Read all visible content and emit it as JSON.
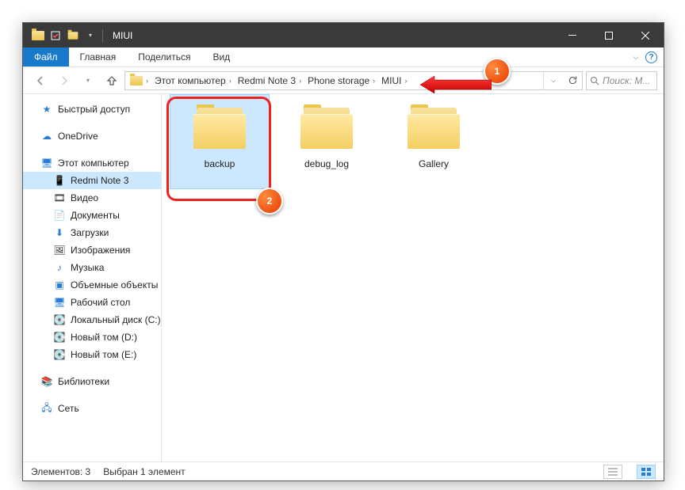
{
  "window": {
    "title": "MIUI"
  },
  "ribbon": {
    "file": "Файл",
    "tabs": [
      "Главная",
      "Поделиться",
      "Вид"
    ]
  },
  "breadcrumbs": [
    "Этот компьютер",
    "Redmi Note 3",
    "Phone storage",
    "MIUI"
  ],
  "search": {
    "placeholder": "Поиск: M..."
  },
  "navpane": {
    "quick_access": "Быстрый доступ",
    "onedrive": "OneDrive",
    "this_pc": "Этот компьютер",
    "items": [
      "Redmi Note 3",
      "Видео",
      "Документы",
      "Загрузки",
      "Изображения",
      "Музыка",
      "Объемные объекты",
      "Рабочий стол",
      "Локальный диск (C:)",
      "Новый том (D:)",
      "Новый том (E:)"
    ],
    "libraries": "Библиотеки",
    "network": "Сеть"
  },
  "folders": [
    {
      "name": "backup",
      "selected": true
    },
    {
      "name": "debug_log",
      "selected": false
    },
    {
      "name": "Gallery",
      "selected": false
    }
  ],
  "status": {
    "count": "Элементов: 3",
    "selected": "Выбран 1 элемент"
  },
  "annotations": {
    "badge1": "1",
    "badge2": "2"
  }
}
